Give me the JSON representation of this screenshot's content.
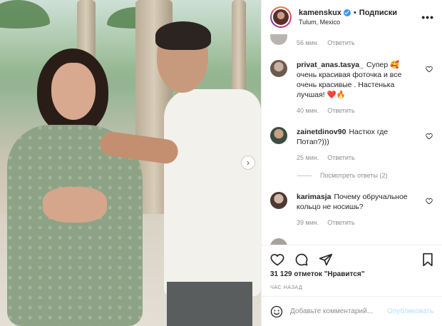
{
  "post": {
    "username": "kamenskux",
    "follow_label": "Подписки",
    "separator": "•",
    "location": "Tulum, Mexico",
    "more_label": "•••"
  },
  "comments": {
    "partial_top": {
      "time": "56 мин.",
      "reply": "Ответить"
    },
    "items": [
      {
        "username": "privat_anas.tasya_",
        "text": "Супер 🥰 очень красивая фоточка и все очень красивые . Настенька лучшая! ❤️🔥",
        "time": "40 мин.",
        "reply": "Ответить"
      },
      {
        "username": "zainetdinov90",
        "text": "Настюх где Потап?)))",
        "time": "25 мин.",
        "reply": "Ответить"
      },
      {
        "username": "karimasja",
        "text": "Почему обручальное кольцо не носишь?",
        "time": "39 мин.",
        "reply": "Ответить"
      }
    ],
    "view_replies": "Посмотреть ответы (2)"
  },
  "actions": {
    "likes": "31 129 отметок \"Нравится\"",
    "time_ago": "ЧАС НАЗАД"
  },
  "add_comment": {
    "placeholder": "Добавьте комментарий...",
    "publish": "Опубликовать"
  },
  "colors": {
    "verified": "#3897f0",
    "meta": "#8e8e8e",
    "publish_disabled": "#b2dffc"
  }
}
